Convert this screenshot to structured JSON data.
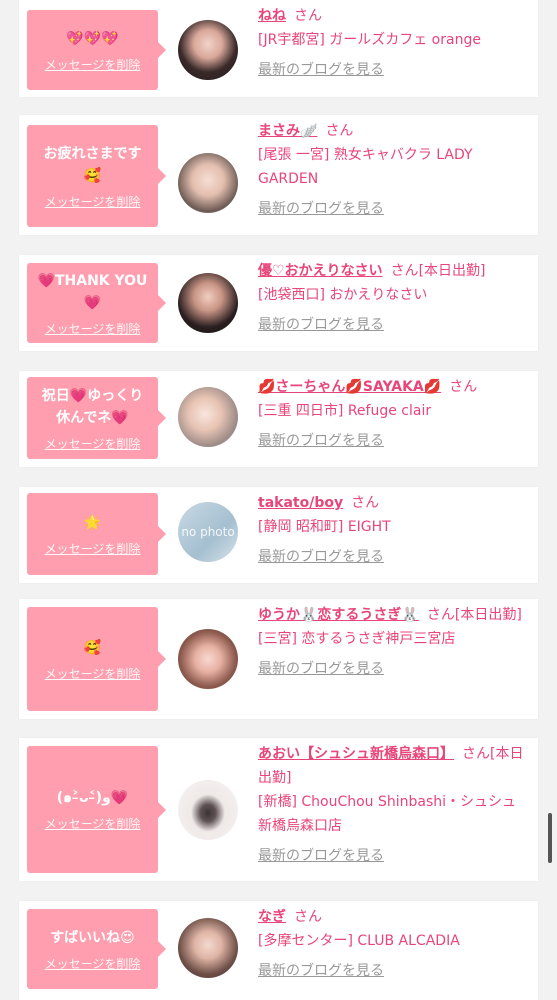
{
  "colors": {
    "accent": "#e8457a",
    "bubble": "#ff9eae",
    "link_gray": "#999999"
  },
  "delete_label": "メッセージを削除",
  "blog_label": "最新のブログを見る",
  "san": "さん",
  "items": [
    {
      "message": "💖💖💖",
      "name": "ねね",
      "status": "",
      "shop": "[JR宇都宮] ガールズカフェ orange",
      "avatar": "photo"
    },
    {
      "message": "お疲れさまです🥰",
      "name": "まさみ🪽",
      "status": "",
      "shop": "[尾張 一宮] 熟女キャバクラ LADY GARDEN",
      "avatar": "photo"
    },
    {
      "message": "💗THANK YOU💗",
      "name": "優♡おかえりなさい",
      "status": "[本日出勤]",
      "shop": "[池袋西口] おかえりなさい",
      "avatar": "photo"
    },
    {
      "message": "祝日💗ゆっくり休んでネ💗",
      "name": "💋さーちゃん💋SAYAKA💋",
      "status": "",
      "shop": "[三重 四日市] Refuge clair",
      "avatar": "photo"
    },
    {
      "message": "🌟",
      "name": "takato/boy",
      "status": "",
      "shop": "[静岡 昭和町] EIGHT",
      "avatar": "no photo"
    },
    {
      "message": "🥰",
      "name": "ゆうか🐰恋するうさぎ🐰",
      "status": "[本日出勤]",
      "shop": "[三宮] 恋するうさぎ神戸三宮店",
      "avatar": "photo"
    },
    {
      "message": "(๑˃̵ᴗ˂̵)ﻭ💗",
      "name": "あおい【シュシュ新橋烏森口】",
      "status": "[本日出勤]",
      "shop": "[新橋] ChouChou Shinbashi・シュシュ新橋烏森口店",
      "avatar": "photo"
    },
    {
      "message": "すばいいね😍",
      "name": "なぎ",
      "status": "",
      "shop": "[多摩センター] CLUB ALCADIA",
      "avatar": "photo"
    }
  ]
}
